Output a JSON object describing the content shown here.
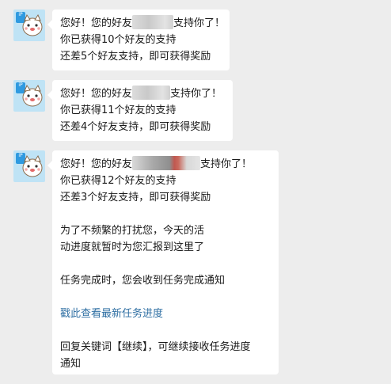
{
  "avatar": {
    "badge_text": "iP",
    "icon": "cartoon-cat-icon"
  },
  "messages": [
    {
      "greeting_pre": "您好！您的好友",
      "greeting_post": "支持你了！",
      "line2": "你已获得10个好友的支持",
      "line3": "还差5个好友支持，即可获得奖励"
    },
    {
      "greeting_pre": "您好！您的好友",
      "greeting_post": "支持你了！",
      "line2": "你已获得11个好友的支持",
      "line3": "还差4个好友支持，即可获得奖励"
    },
    {
      "greeting_pre": "您好！您的好友",
      "greeting_post": "支持你了！",
      "line2": "你已获得12个好友的支持",
      "line3": "还差3个好友支持，即可获得奖励",
      "notice_1": "为了不频繁的打扰您，今天的活",
      "notice_2": "动进度就暂时为您汇报到这里了",
      "complete_note": "任务完成时，您会收到任务完成通知",
      "link_text": "戳此查看最新任务进度",
      "reply_1": "回复关键词【继续】，可继续接收任务进度",
      "reply_2": "通知"
    }
  ],
  "colors": {
    "background": "#ededed",
    "bubble": "#ffffff",
    "link": "#2f6fa3"
  }
}
